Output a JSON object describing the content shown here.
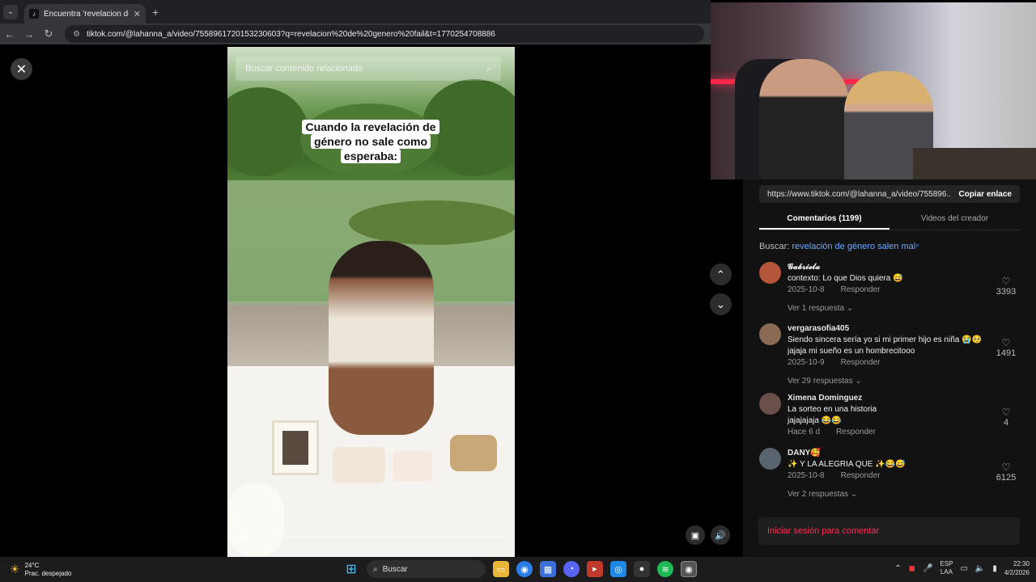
{
  "browser": {
    "tab_title": "Encuentra 'revelacion de g...",
    "url": "tiktok.com/@lahanna_a/video/7558961720153230603?q=revelacion%20de%20genero%20fail&t=1770254708886"
  },
  "video": {
    "search_placeholder": "Buscar contenido relacionado",
    "caption": [
      "Cuando la revelación de",
      "género no sale como",
      "esperaba:"
    ],
    "progress": 0.05
  },
  "panel": {
    "link_url": "https://www.tiktok.com/@lahanna_a/video/755896...",
    "copy_label": "Copiar enlace",
    "tabs": [
      {
        "label": "Comentarios (1199)",
        "active": true
      },
      {
        "label": "Videos del creador",
        "active": false
      }
    ],
    "search_prefix": "Buscar:",
    "search_query": "revelación de género salen mal",
    "comments": [
      {
        "user": "𝓖𝓪𝓫𝓻𝓲𝓮𝓵𝓪",
        "text": "contexto: Lo que Dios quiera 😅",
        "date": "2025-10-8",
        "reply": "Responder",
        "likes": "3393",
        "more": "Ver 1 respuesta",
        "avatar_color": "#b5563c"
      },
      {
        "user": "vergarasofia405",
        "text": "Siendo sincera sería yo si mi primer hijo es niña 😭🥺 jajaja mi sueño es un hombrecitooo",
        "date": "2025-10-9",
        "reply": "Responder",
        "likes": "1491",
        "more": "Ver 29 respuestas",
        "avatar_color": "#8b6a55"
      },
      {
        "user": "Ximena Dominguez",
        "text": "La sorteo en una historia jajajajaja 😂😂",
        "date": "Hace 6 d",
        "reply": "Responder",
        "likes": "4",
        "more": "",
        "avatar_color": "#6b4f4a"
      },
      {
        "user": "DANY🥰",
        "text": "✨ Y LA ALEGRIA QUE ✨😂😅",
        "date": "2025-10-8",
        "reply": "Responder",
        "likes": "6125",
        "more": "Ver 2 respuestas",
        "avatar_color": "#5a6470"
      }
    ],
    "login_label": "Iniciar sesión para comentar"
  },
  "taskbar": {
    "temp": "24°C",
    "weather": "Prac. despejado",
    "search_label": "Buscar",
    "lang_top": "ESP",
    "lang_bottom": "LAA",
    "time": "22:30",
    "date": "4/2/2026"
  }
}
